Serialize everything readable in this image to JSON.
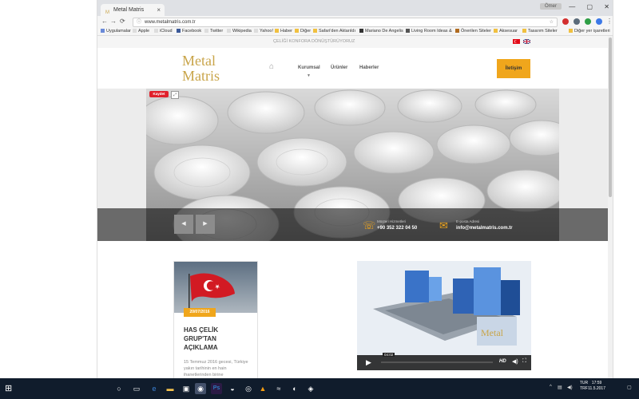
{
  "browser": {
    "tab_title": "Metal Matris",
    "tab_close": "×",
    "url": "www.metalmatris.com.tr",
    "user_chip": "Ömer",
    "window_controls": [
      "—",
      "▢",
      "✕"
    ],
    "bookmarks": [
      "Uygulamalar",
      "Apple",
      "iCloud",
      "Facebook",
      "Twitter",
      "Wikipedia",
      "Yahoo!",
      "Haber",
      "Diğer",
      "Safari'den Aktarıldı",
      "Mariano De Angelis",
      "Living Room Ideas &",
      "Önerilen Siteler",
      "Aksesuar",
      "Tasarım Siteler",
      "Diğer yer işaretleri"
    ]
  },
  "site": {
    "slogan": "ÇELİĞİ KONFORA DÖNÜŞTÜRÜYORUZ",
    "logo_line1": "Metal",
    "logo_line2": "Matris",
    "menu": [
      "Kurumsal",
      "Ürünler",
      "Haberler"
    ],
    "cta": "İletişim",
    "hero": {
      "pin_label": "Kaydet",
      "contact": [
        {
          "label": "Müşteri Hizmetleri",
          "value": "+90 352 322 04 50"
        },
        {
          "label": "E-posta Adresi",
          "value": "info@metalmatris.com.tr"
        }
      ],
      "prev_arrow": "◀",
      "next_arrow": "▶"
    },
    "news": {
      "date": "20/07/2016",
      "title": "HAS ÇELİK GRUP'TAN AÇIKLAMA",
      "body": "15 Temmuz 2016 gecesi, Türkiye yakın tarihinin en hain ihanetlerinden birine"
    },
    "video": {
      "time": "04:02",
      "hd": "HD"
    }
  },
  "taskbar": {
    "lang": "TUR TRF",
    "time": "17:59",
    "date": "11.5.2017"
  }
}
